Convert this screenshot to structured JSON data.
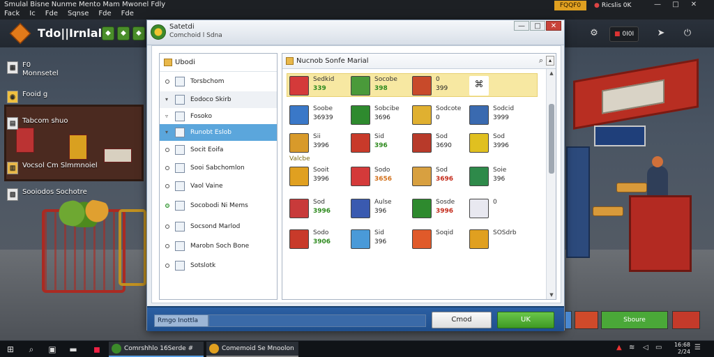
{
  "window": {
    "title": "Smulal Bisne Nunme Mento Mam Mwonel Fdly",
    "menu": [
      "Fack",
      "Ic",
      "Fde",
      "Sqnse",
      "Fde",
      "Fde"
    ],
    "account_badge": "FQQF0",
    "user_label": "Ricslis 0K",
    "controls": [
      "—",
      "□",
      "✕"
    ]
  },
  "app": {
    "name": "Tdo||Irnlal",
    "header_pill": "0I0I",
    "header_icons": [
      "gear-icon",
      "cursor-icon",
      "power-icon"
    ]
  },
  "sidebar": {
    "items": [
      {
        "label": "F0\nMonnsetel",
        "icon": "grid-icon"
      },
      {
        "label": "Fooid g",
        "icon": "food-icon"
      },
      {
        "label": "Tabcom shuo",
        "icon": "document-icon"
      },
      {
        "label": "Vocsol Cm Slmmnoiel",
        "icon": "chart-icon"
      },
      {
        "label": "Sooiodos Sochotre",
        "icon": "shelf-icon"
      }
    ]
  },
  "dialog": {
    "title": "Satetdi",
    "subtitle": "Comchoid l Sdna",
    "controls": [
      "—",
      "□",
      "✕"
    ],
    "tree": {
      "header": "Ubodi",
      "nodes": [
        {
          "label": "Torsbchom",
          "expander": "",
          "state": "plain"
        },
        {
          "label": "Eodoco Skirb",
          "expander": "▾",
          "state": "alt"
        },
        {
          "label": "Fosoko",
          "expander": "▿",
          "state": "plain"
        },
        {
          "label": "Runobt Eslob",
          "expander": "▾",
          "state": "selected"
        },
        {
          "label": "Socit Eoifa",
          "expander": "",
          "state": "plain"
        },
        {
          "label": "Sooi Sabchomlon",
          "expander": "",
          "state": "plain"
        },
        {
          "label": "Vaol Vaine",
          "expander": "",
          "state": "plain"
        },
        {
          "label": "Socobodi Ni Mems",
          "expander": "",
          "state": "green"
        },
        {
          "label": "Socsond Marlod",
          "expander": "",
          "state": "plain"
        },
        {
          "label": "Marobn Soch Bone",
          "expander": "",
          "state": "plain"
        },
        {
          "label": "Sotslotk",
          "expander": "",
          "state": "plain"
        }
      ]
    },
    "grid": {
      "header": "Nucnob Sonfe Marial",
      "category_label": "Valcbe",
      "items": [
        {
          "name": "Sedkid",
          "price": "339",
          "tone": "g",
          "color": "#d43a3a"
        },
        {
          "name": "Socobe",
          "price": "398",
          "tone": "g",
          "color": "#4a9a3a"
        },
        {
          "name": "0",
          "price": "399",
          "tone": "",
          "color": "#c84a2a"
        },
        {
          "name": "",
          "price": "",
          "tone": "",
          "color": "#ffffff"
        },
        {
          "name": "Soobe",
          "price": "36939",
          "tone": "",
          "color": "#3a78c8"
        },
        {
          "name": "Sobcibe",
          "price": "3696",
          "tone": "",
          "color": "#2e8a2e"
        },
        {
          "name": "Sodcote",
          "price": "0",
          "tone": "",
          "color": "#e0b030"
        },
        {
          "name": "Sodcid",
          "price": "3999",
          "tone": "",
          "color": "#3a6ab0"
        },
        {
          "name": "Sii",
          "price": "3996",
          "tone": "",
          "color": "#d89a2a"
        },
        {
          "name": "Sid",
          "price": "396",
          "tone": "g",
          "color": "#c83a2a"
        },
        {
          "name": "Sod",
          "price": "3690",
          "tone": "",
          "color": "#b83a2a"
        },
        {
          "name": "Sod",
          "price": "3996",
          "tone": "",
          "color": "#e0c020"
        },
        {
          "name": "Sooit",
          "price": "3996",
          "tone": "",
          "color": "#e0a020"
        },
        {
          "name": "Sodo",
          "price": "3656",
          "tone": "o",
          "color": "#d43a3a"
        },
        {
          "name": "Sod",
          "price": "3696",
          "tone": "r",
          "color": "#d8a040"
        },
        {
          "name": "Soie",
          "price": "396",
          "tone": "",
          "color": "#2e8a4a"
        },
        {
          "name": "Sod",
          "price": "3996",
          "tone": "g",
          "color": "#c83a3a"
        },
        {
          "name": "Aulse",
          "price": "396",
          "tone": "",
          "color": "#3a5ab0"
        },
        {
          "name": "Sosde",
          "price": "3996",
          "tone": "r",
          "color": "#2e8a2e"
        },
        {
          "name": "0",
          "price": "",
          "tone": "",
          "color": "#e8e8f0"
        },
        {
          "name": "Sodo",
          "price": "3906",
          "tone": "g",
          "color": "#c83a2a"
        },
        {
          "name": "Sid",
          "price": "396",
          "tone": "",
          "color": "#4a9ad8"
        },
        {
          "name": "Soqid",
          "price": "",
          "tone": "r",
          "color": "#e05a2a"
        },
        {
          "name": "SOSdrb",
          "price": "",
          "tone": "",
          "color": "#e0a020"
        }
      ]
    },
    "footer": {
      "status": "Rmgo Inottla",
      "cancel": "Cmod",
      "ok": "UK"
    }
  },
  "gamebar": {
    "action": "Sboure"
  },
  "taskbar": {
    "tasks": [
      "Comrshhlo 16Serde #",
      "Comemoid Se Mnoolon"
    ],
    "clock": "16:68\n2/24"
  },
  "colors": {
    "accent": "#5ba6dc",
    "ok_button": "#3f9a24",
    "footer_blue": "#1f4f8d",
    "highlight_band": "#f7e8a2"
  }
}
